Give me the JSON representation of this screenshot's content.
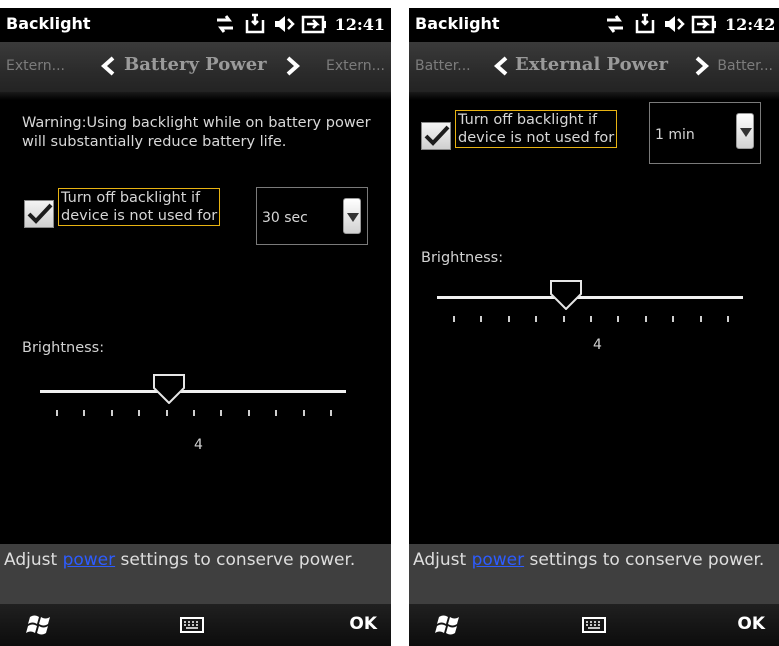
{
  "screens": [
    {
      "title": "Backlight",
      "time": "12:41",
      "pivot": {
        "prev": "Extern...",
        "current": "Battery Power",
        "next": "Extern..."
      },
      "warning": "Warning:Using backlight while on battery power will substantially reduce battery life.",
      "checkbox": {
        "checked": true,
        "label_line1": "Turn off backlight if",
        "label_line2": "device is not used for"
      },
      "timeout": {
        "selected": "30 sec"
      },
      "brightness": {
        "label": "Brightness:",
        "value": "4",
        "level": 4,
        "min": 0,
        "max": 10
      },
      "bottom": {
        "prefix": "Adjust",
        "link": "power",
        "suffix": "settings to conserve power."
      },
      "softkeys": {
        "right": "OK"
      }
    },
    {
      "title": "Backlight",
      "time": "12:42",
      "pivot": {
        "prev": "Batter...",
        "current": "External Power",
        "next": "Batter..."
      },
      "checkbox": {
        "checked": true,
        "label_line1": "Turn off backlight if",
        "label_line2": "device is not used for"
      },
      "timeout": {
        "selected": "1 min"
      },
      "brightness": {
        "label": "Brightness:",
        "value": "4",
        "level": 4,
        "min": 0,
        "max": 10
      },
      "bottom": {
        "prefix": "Adjust",
        "link": "power",
        "suffix": "settings to conserve power."
      },
      "softkeys": {
        "right": "OK"
      }
    }
  ],
  "icons": [
    "sync-arrows-icon",
    "inbox-notification-icon",
    "speaker-muted-icon",
    "battery-charging-icon",
    "windows-start-icon",
    "keyboard-icon",
    "chevron-left-icon",
    "chevron-right-icon",
    "dropdown-arrow-icon",
    "checkmark-icon"
  ],
  "colors": {
    "highlight_border": "#e8b312",
    "link": "#2d5cff",
    "background": "#000000",
    "bottom_bar": "#3f3f3f"
  }
}
